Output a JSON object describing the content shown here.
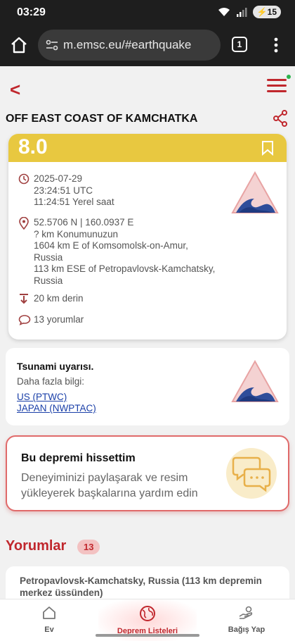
{
  "status": {
    "time": "03:29",
    "battery": "15"
  },
  "browser": {
    "url": "m.emsc.eu/#earthquake",
    "tab_count": "1"
  },
  "header": {
    "back_label": "<"
  },
  "event": {
    "region": "OFF EAST COAST OF KAMCHATKA",
    "magnitude": "8.0",
    "date": "2025-07-29",
    "time_utc": "23:24:51 UTC",
    "time_local": "11:24:51 Yerel saat",
    "coordinates": "52.5706 N | 160.0937 E",
    "location_lines": [
      "? km Konumunuzun",
      "1604 km E of Komsomolsk-on-Amur,",
      "Russia",
      "113 km ESE of Petropavlovsk-Kamchatsky,",
      "Russia"
    ],
    "depth": "20 km derin",
    "comments_count": "13",
    "comments_label": "yorumlar"
  },
  "tsunami": {
    "title": "Tsunami uyarısı.",
    "more_info": "Daha fazla bilgi:",
    "links": [
      "US (PTWC)",
      "JAPAN (NWPTAC)"
    ]
  },
  "felt": {
    "title": "Bu depremi hissettim",
    "description": "Deneyiminizi paylaşarak ve resim yükleyerek başkalarına yardım edin"
  },
  "comments": {
    "title": "Yorumlar",
    "count": "13",
    "first_location": "Petropavlovsk-Kamchatsky, Russia (113 km depremin merkez üssünden)"
  },
  "nav": {
    "items": [
      {
        "label": "Ev",
        "icon": "home-icon"
      },
      {
        "label": "Deprem Listeleri",
        "icon": "globe-icon"
      },
      {
        "label": "Bağış Yap",
        "icon": "donate-icon"
      }
    ]
  },
  "colors": {
    "accent": "#c0272d",
    "magnitude_bg": "#e8c840",
    "link": "#1a3fa8"
  }
}
